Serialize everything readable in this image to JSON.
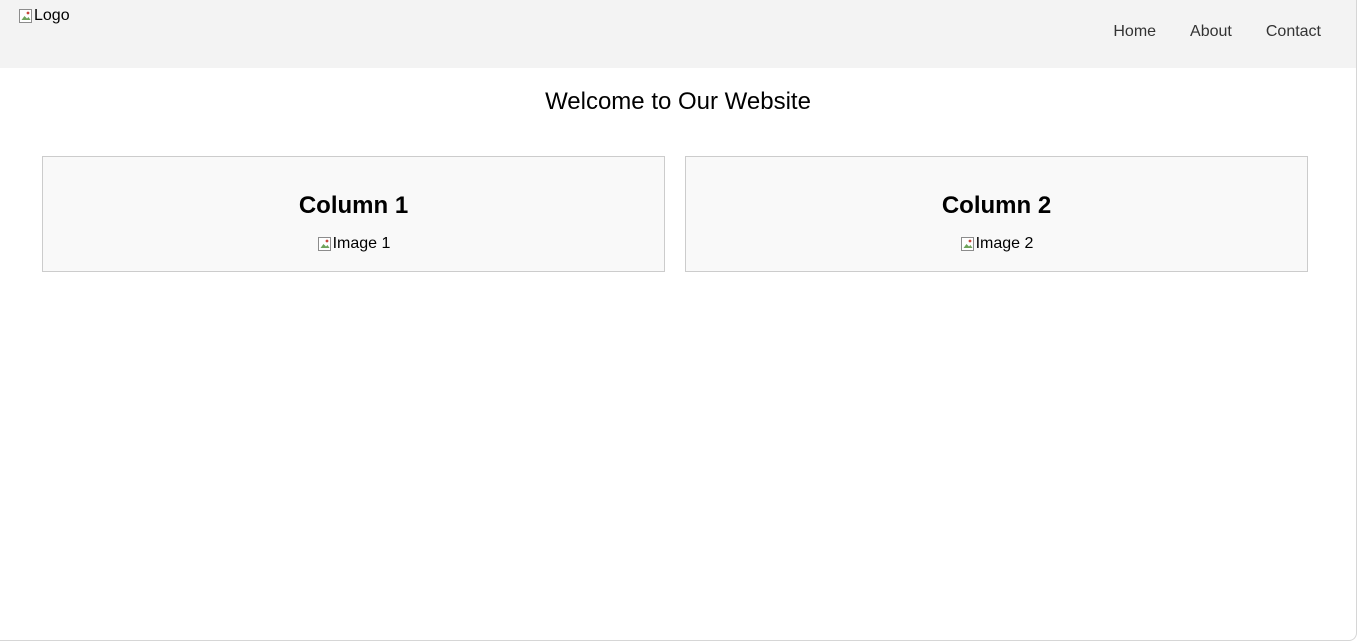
{
  "header": {
    "logo_alt": "Logo",
    "nav": {
      "home": "Home",
      "about": "About",
      "contact": "Contact"
    }
  },
  "main": {
    "title": "Welcome to Our Website",
    "columns": [
      {
        "heading": "Column 1",
        "image_alt": "Image 1"
      },
      {
        "heading": "Column 2",
        "image_alt": "Image 2"
      }
    ]
  },
  "icons": {
    "broken_image": "broken-image-icon"
  },
  "colors": {
    "header_bg": "#f3f3f3",
    "column_bg": "#f9f9f9",
    "column_border": "#cccccc",
    "nav_text": "#333333"
  }
}
